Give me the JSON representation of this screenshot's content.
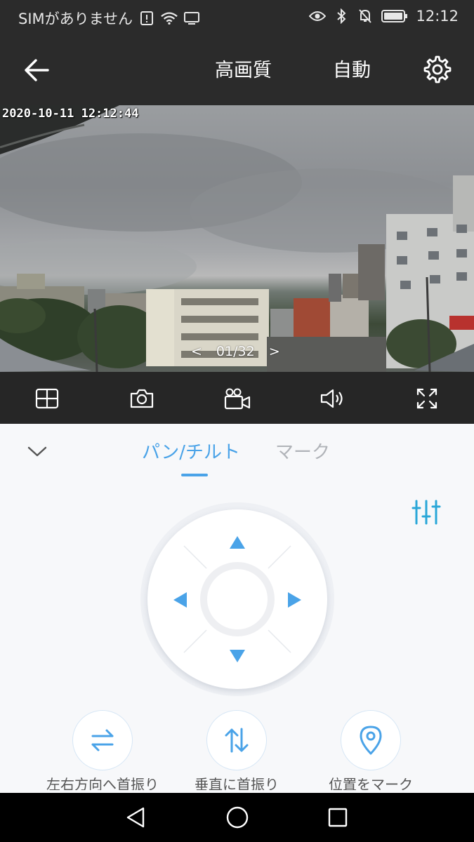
{
  "status_bar": {
    "carrier": "SIMがありません",
    "time": "12:12",
    "icons": [
      "alert-icon",
      "wifi-icon",
      "cast-icon",
      "eye-icon",
      "bluetooth-icon",
      "mute-icon",
      "battery-icon"
    ]
  },
  "app_bar": {
    "back_icon": "back-arrow-icon",
    "quality_label": "高画質",
    "mode_label": "自動",
    "settings_icon": "gear-icon"
  },
  "video": {
    "timestamp": "2020-10-11  12:12:44",
    "prev_symbol": "<",
    "page_indicator": "01/32",
    "next_symbol": ">"
  },
  "toolbar": {
    "items": [
      {
        "name": "layout-grid-icon"
      },
      {
        "name": "camera-icon"
      },
      {
        "name": "video-record-icon"
      },
      {
        "name": "speaker-icon"
      },
      {
        "name": "fullscreen-icon"
      }
    ]
  },
  "panel": {
    "tabs": [
      {
        "label": "パン/チルト",
        "active": true
      },
      {
        "label": "マーク",
        "active": false
      }
    ],
    "accent_color": "#4aa3e8",
    "actions": [
      {
        "icon": "swap-horizontal-icon",
        "label": "左右方向へ首振り"
      },
      {
        "icon": "swap-vertical-icon",
        "label": "垂直に首振り"
      },
      {
        "icon": "location-pin-icon",
        "label": "位置をマーク"
      }
    ]
  },
  "nav_bar": {
    "buttons": [
      "nav-back-icon",
      "nav-home-icon",
      "nav-recents-icon"
    ]
  }
}
